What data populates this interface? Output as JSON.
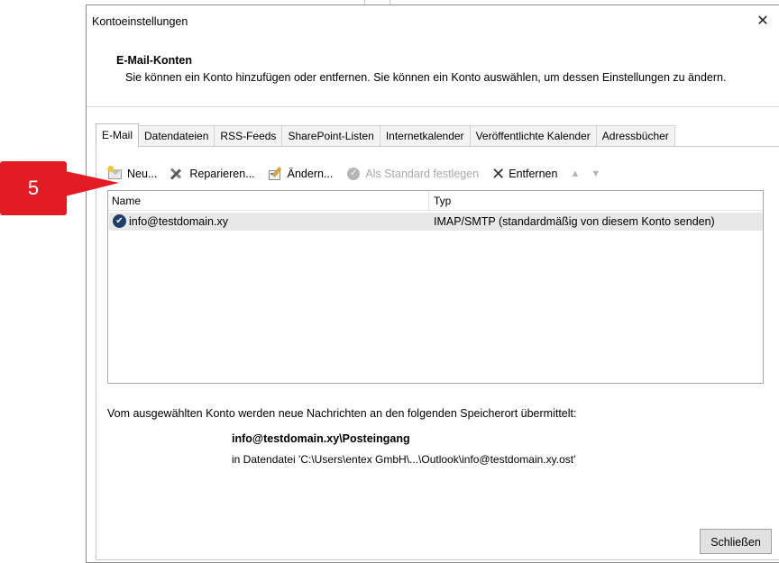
{
  "window": {
    "title": "Kontoeinstellungen",
    "close_glyph": "✕"
  },
  "header": {
    "title": "E-Mail-Konten",
    "description": "Sie können ein Konto hinzufügen oder entfernen. Sie können ein Konto auswählen, um dessen Einstellungen zu ändern."
  },
  "tabs": [
    {
      "label": "E-Mail",
      "active": true
    },
    {
      "label": "Datendateien",
      "active": false
    },
    {
      "label": "RSS-Feeds",
      "active": false
    },
    {
      "label": "SharePoint-Listen",
      "active": false
    },
    {
      "label": "Internetkalender",
      "active": false
    },
    {
      "label": "Veröffentlichte Kalender",
      "active": false
    },
    {
      "label": "Adressbücher",
      "active": false
    }
  ],
  "toolbar": {
    "new_label": "Neu...",
    "repair_label": "Reparieren...",
    "change_label": "Ändern...",
    "set_default_label": "Als Standard festlegen",
    "remove_label": "Entfernen",
    "up_glyph": "▲",
    "down_glyph": "▼",
    "icons": {
      "new": "new-mail-icon",
      "repair": "repair-tools-icon",
      "change": "change-icon",
      "set_default": "check-circle-icon",
      "remove": "x-icon"
    }
  },
  "accounts": {
    "columns": [
      "Name",
      "Typ"
    ],
    "rows": [
      {
        "name": "info@testdomain.xy",
        "type": "IMAP/SMTP (standardmäßig von diesem Konto senden)",
        "default_glyph": "✔",
        "selected": true
      }
    ]
  },
  "delivery": {
    "info": "Vom ausgewählten Konto werden neue Nachrichten an den folgenden Speicherort übermittelt:",
    "folder": "info@testdomain.xy\\Posteingang",
    "file": "in Datendatei 'C:\\Users\\entex GmbH\\...\\Outlook\\info@testdomain.xy.ost'"
  },
  "buttons": {
    "close_label": "Schließen"
  },
  "annotation": {
    "step_number": "5",
    "color": "#e31b23"
  }
}
